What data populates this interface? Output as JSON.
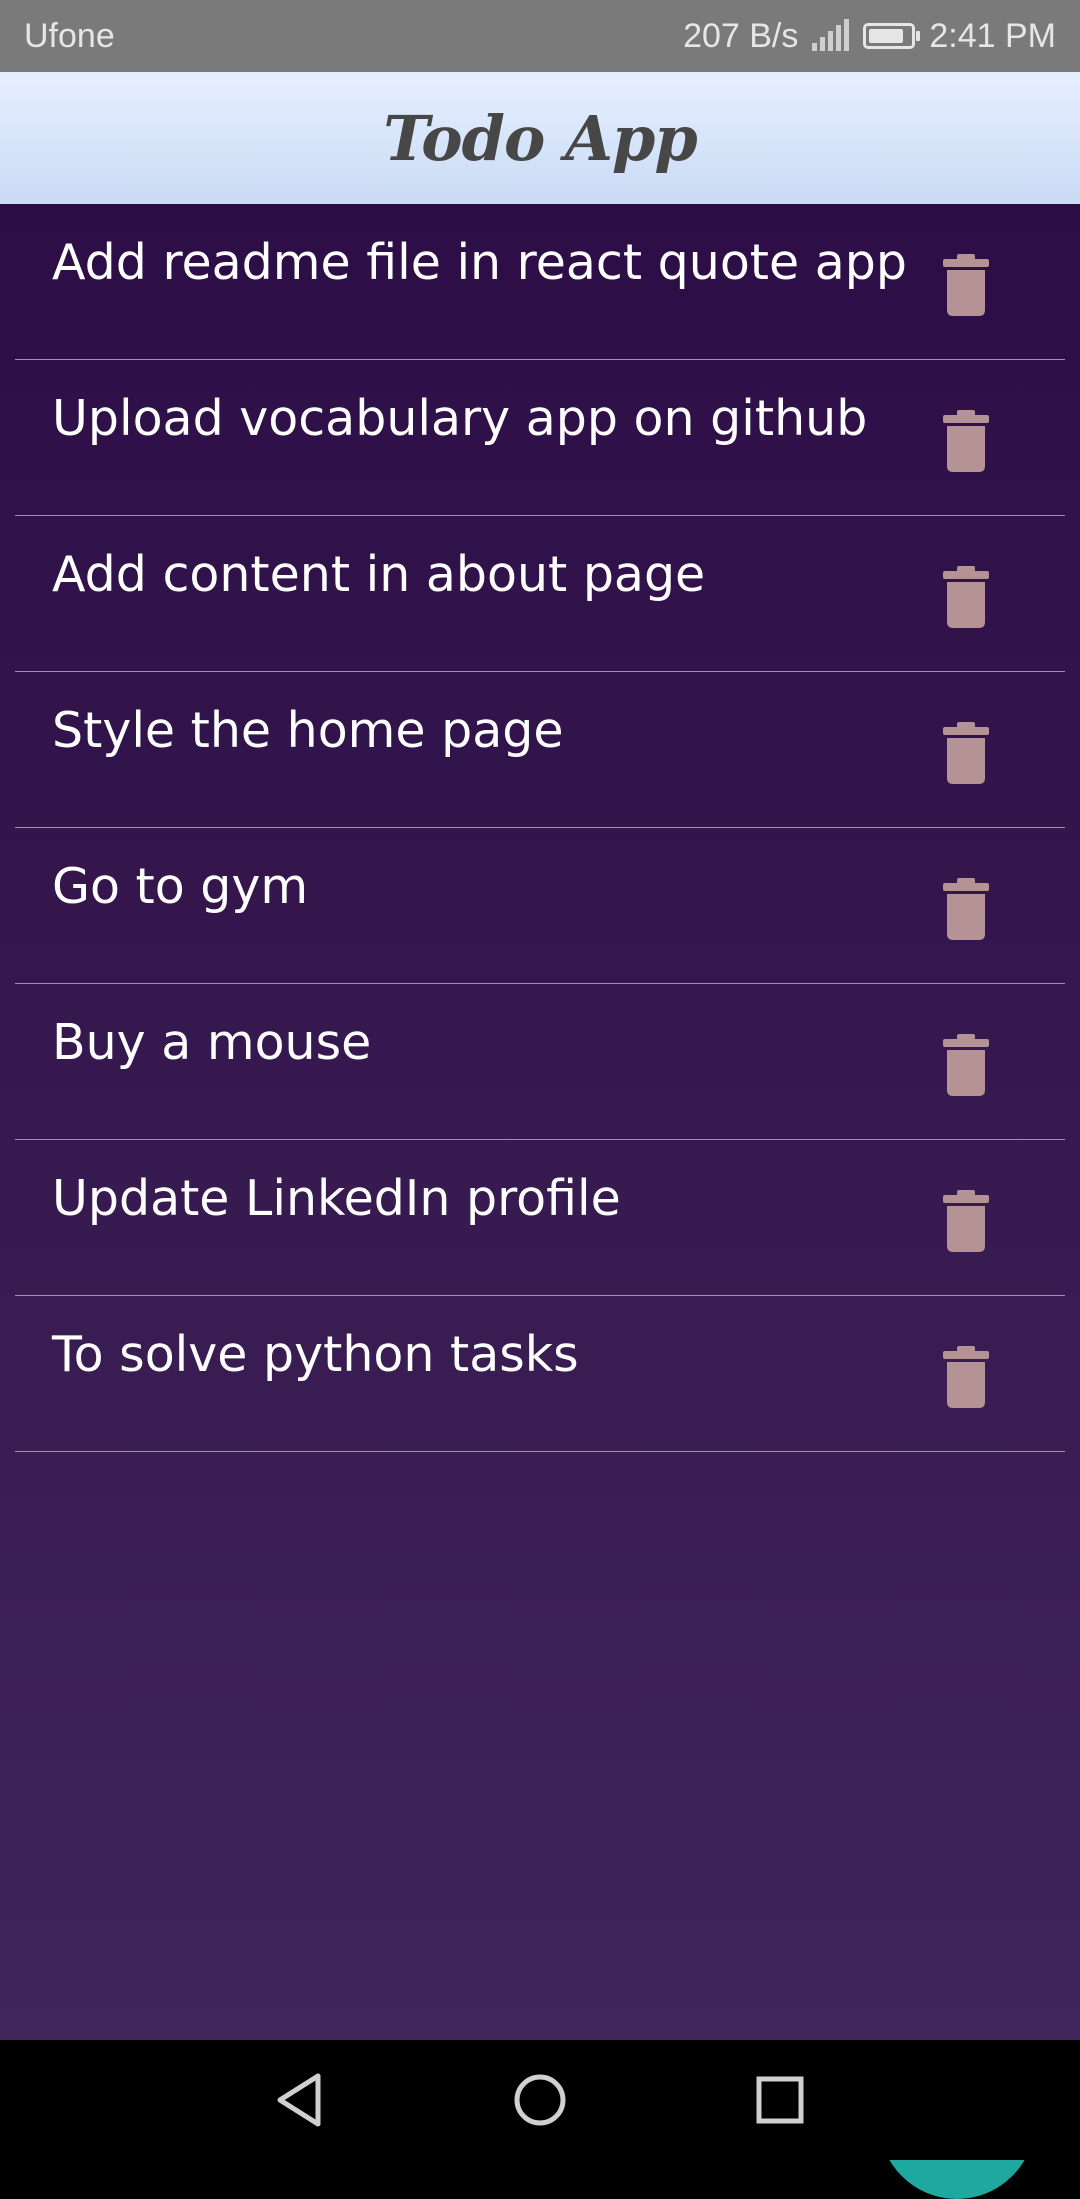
{
  "status_bar": {
    "carrier": "Ufone",
    "network_speed": "207 B/s",
    "signal_icon": "signal-icon",
    "battery_icon": "battery-icon",
    "time": "2:41 PM"
  },
  "header": {
    "title": "Todo App"
  },
  "todos": [
    {
      "text": "Add readme file in react quote app"
    },
    {
      "text": "Upload vocabulary app on github"
    },
    {
      "text": "Add content in about page"
    },
    {
      "text": "Style the home page"
    },
    {
      "text": "Go to gym"
    },
    {
      "text": "Buy a mouse"
    },
    {
      "text": "Update LinkedIn profile"
    },
    {
      "text": "To solve python tasks"
    }
  ],
  "item_actions": {
    "delete_icon": "trash-icon"
  },
  "fab": {
    "icon": "plus-icon"
  },
  "nav_bar": {
    "back_icon": "back-triangle-icon",
    "home_icon": "home-circle-icon",
    "recents_icon": "recents-square-icon"
  },
  "colors": {
    "header_gradient_top": "#e6efff",
    "header_gradient_bottom": "#cadbf4",
    "list_bg_top": "#2d0d46",
    "list_bg_bottom": "#3f2559",
    "fab": "#1ea89f",
    "trash_icon": "#b59294",
    "divider": "#a38fb5"
  }
}
